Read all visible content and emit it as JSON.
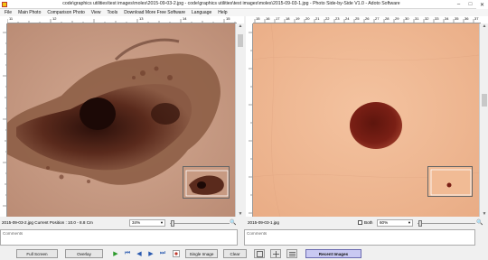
{
  "window": {
    "title": "code\\graphics utilities\\test images\\moles\\2015-09-03-2.jpg - code\\graphics utilities\\test images\\moles\\2015-09-03-1.jpg - Photo Side-by-Side V1.0 - Adoto Software",
    "controls": [
      "–",
      "□",
      "✕"
    ]
  },
  "menu": [
    "File",
    "Main Photo",
    "Comparison Photo",
    "View",
    "Tools",
    "Download More Free Software",
    "Language",
    "Help"
  ],
  "left_pane": {
    "ruler_labels": [
      "11",
      "12",
      "13",
      "14",
      "15"
    ],
    "status": "2015-09-03-2.jpg Current Position : 10.0 - 8.8 Cm",
    "zoom": "34%",
    "comments_placeholder": "Comments"
  },
  "right_pane": {
    "ruler_labels": [
      "15",
      "16",
      "17",
      "18",
      "19",
      "20",
      "21",
      "22",
      "23",
      "24",
      "25",
      "26",
      "27",
      "28",
      "29",
      "30",
      "31",
      "32",
      "33",
      "34",
      "35",
      "36",
      "37",
      "38"
    ],
    "status": "2015-09-03-1.jpg",
    "both_label": "Both",
    "zoom": "60%",
    "comments_placeholder": "Comments"
  },
  "toolbar": {
    "full_screen": "Full Screen",
    "overlay": "Overlay",
    "nav": [
      "▶",
      "⏮",
      "◀",
      "▶",
      "⏭"
    ],
    "single_image": "Single Image",
    "clear": "Clear",
    "recent_images": "Recent Images"
  },
  "colors": {
    "skin_left": "#c79a82",
    "mole_dark": "#3b1a12",
    "skin_right": "#f1bb95",
    "mole_right": "#7a1f15",
    "recent_button": "#c9c9f2"
  }
}
